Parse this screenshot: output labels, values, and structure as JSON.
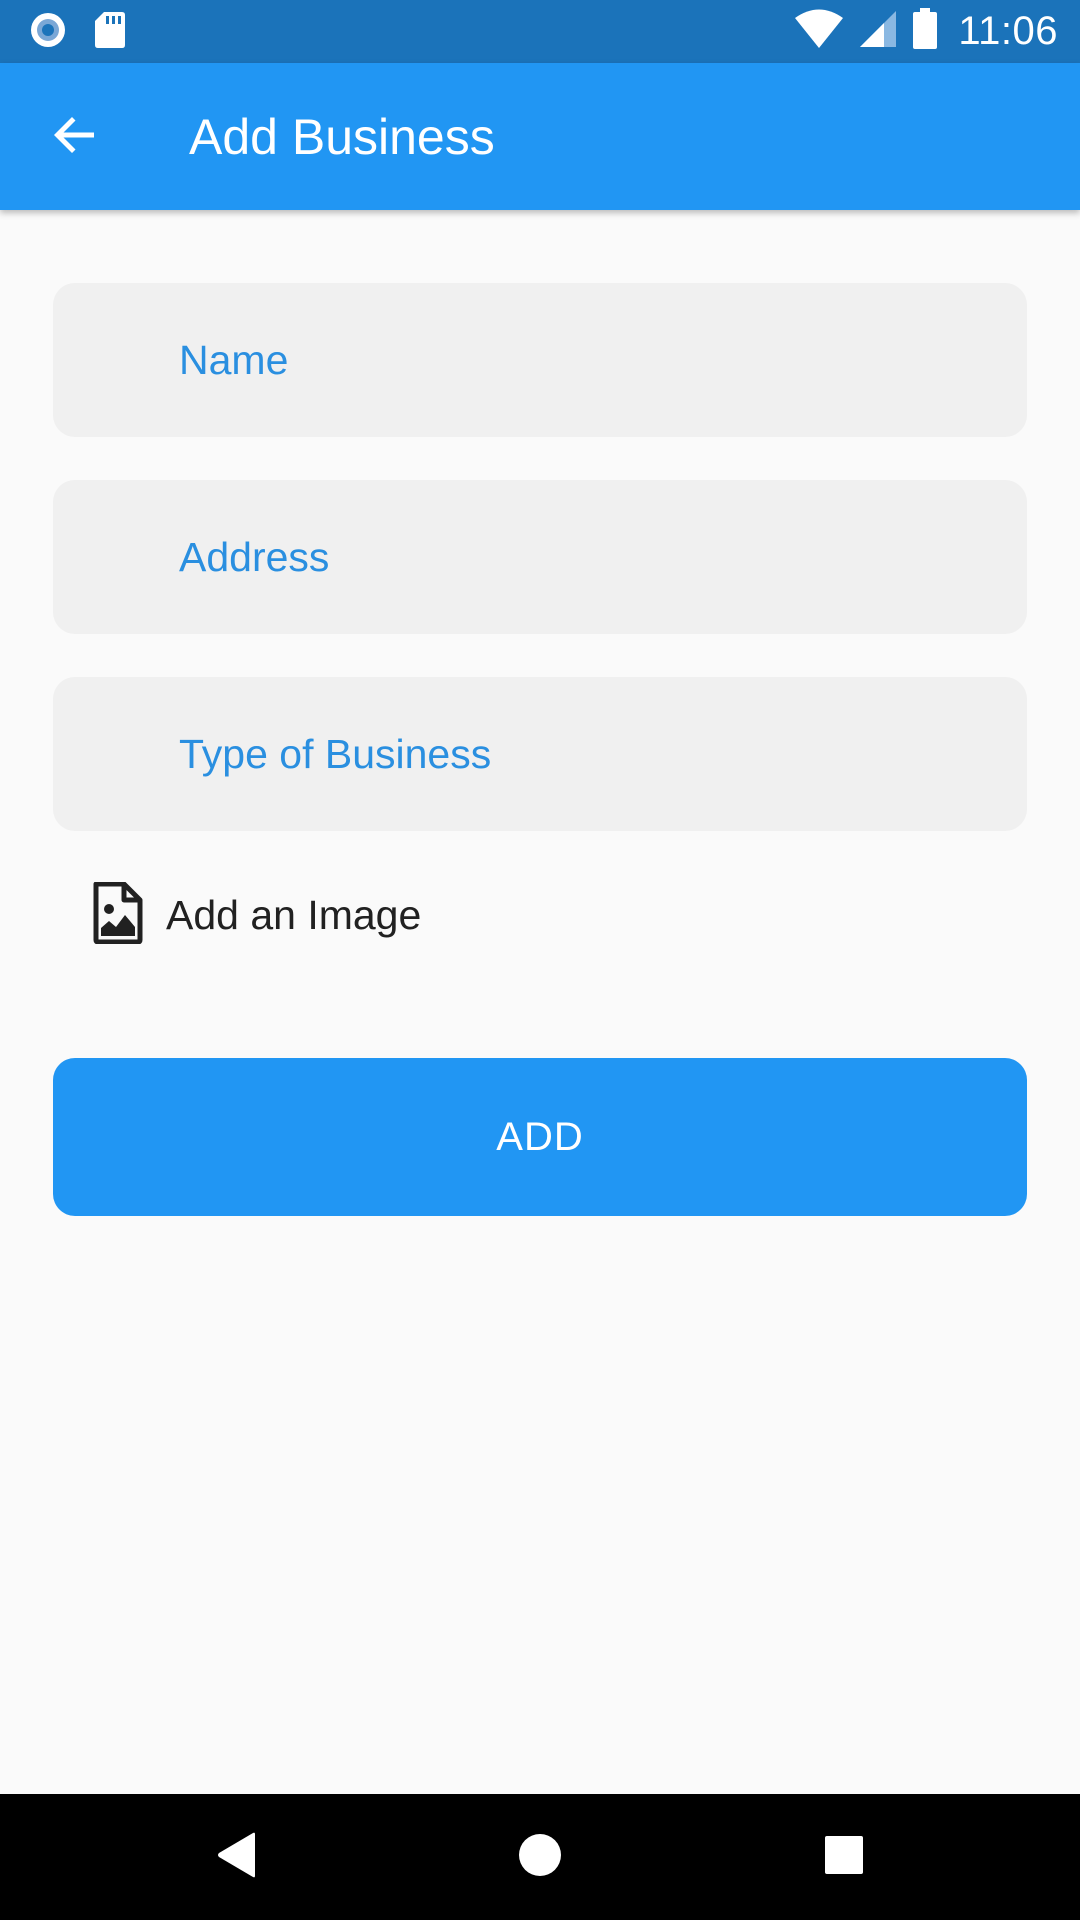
{
  "status_bar": {
    "time": "11:06",
    "icons": [
      "record-icon",
      "sd-card-icon",
      "wifi-icon",
      "cell-signal-icon",
      "battery-icon"
    ]
  },
  "app_bar": {
    "title": "Add Business",
    "back_icon": "arrow-back-icon"
  },
  "form": {
    "name_placeholder": "Name",
    "address_placeholder": "Address",
    "type_placeholder": "Type of Business",
    "add_image_label": "Add an Image",
    "add_image_icon": "image-file-icon",
    "submit_label": "ADD"
  },
  "nav_bar": {
    "icons": [
      "nav-back-icon",
      "nav-home-icon",
      "nav-recents-icon"
    ]
  },
  "colors": {
    "status_bar": "#1b73ba",
    "primary": "#2196f3",
    "field_background": "#f0f0f0",
    "placeholder": "#2a8fe0",
    "background": "#fafafa"
  }
}
